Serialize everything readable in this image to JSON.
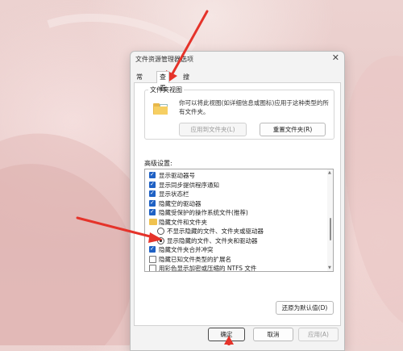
{
  "window": {
    "title": "文件资源管理器选项",
    "close_glyph": "✕"
  },
  "tabs": [
    {
      "label": "常规",
      "active": false
    },
    {
      "label": "查看",
      "active": true
    },
    {
      "label": "搜索",
      "active": false
    }
  ],
  "folder_views": {
    "label": "文件夹视图",
    "description": "你可以将此视图(如详细信息或图标)应用于这种类型的所有文件夹。",
    "apply_button": "应用到文件夹(L)",
    "reset_button": "重置文件夹(R)"
  },
  "advanced": {
    "label": "高级设置:",
    "items": [
      {
        "type": "checkbox",
        "checked": true,
        "indent": 0,
        "label": "显示驱动器号"
      },
      {
        "type": "checkbox",
        "checked": true,
        "indent": 0,
        "label": "显示同步提供程序通知"
      },
      {
        "type": "checkbox",
        "checked": true,
        "indent": 0,
        "label": "显示状态栏"
      },
      {
        "type": "checkbox",
        "checked": true,
        "indent": 0,
        "label": "隐藏空的驱动器"
      },
      {
        "type": "checkbox",
        "checked": true,
        "indent": 0,
        "label": "隐藏受保护的操作系统文件(推荐)"
      },
      {
        "type": "folder",
        "checked": false,
        "indent": 0,
        "label": "隐藏文件和文件夹"
      },
      {
        "type": "radio",
        "checked": false,
        "indent": 1,
        "label": "不显示隐藏的文件、文件夹或驱动器"
      },
      {
        "type": "radio",
        "checked": true,
        "indent": 1,
        "label": "显示隐藏的文件、文件夹和驱动器"
      },
      {
        "type": "checkbox",
        "checked": true,
        "indent": 0,
        "label": "隐藏文件夹合并冲突"
      },
      {
        "type": "checkbox",
        "checked": false,
        "indent": 0,
        "label": "隐藏已知文件类型的扩展名"
      },
      {
        "type": "checkbox",
        "checked": false,
        "indent": 0,
        "label": "用彩色显示加密或压缩的 NTFS 文件"
      },
      {
        "type": "checkbox",
        "checked": false,
        "indent": 0,
        "label": "在标题栏中显示完整路径"
      },
      {
        "type": "checkbox",
        "checked": false,
        "indent": 0,
        "label": "在单独的进程中打开文件夹窗口"
      }
    ],
    "restore_button": "还原为默认值(D)"
  },
  "footer": {
    "ok": "确定",
    "cancel": "取消",
    "apply": "应用(A)"
  },
  "colors": {
    "accent": "#1f61c4",
    "annotation_arrow": "#e5332a"
  }
}
